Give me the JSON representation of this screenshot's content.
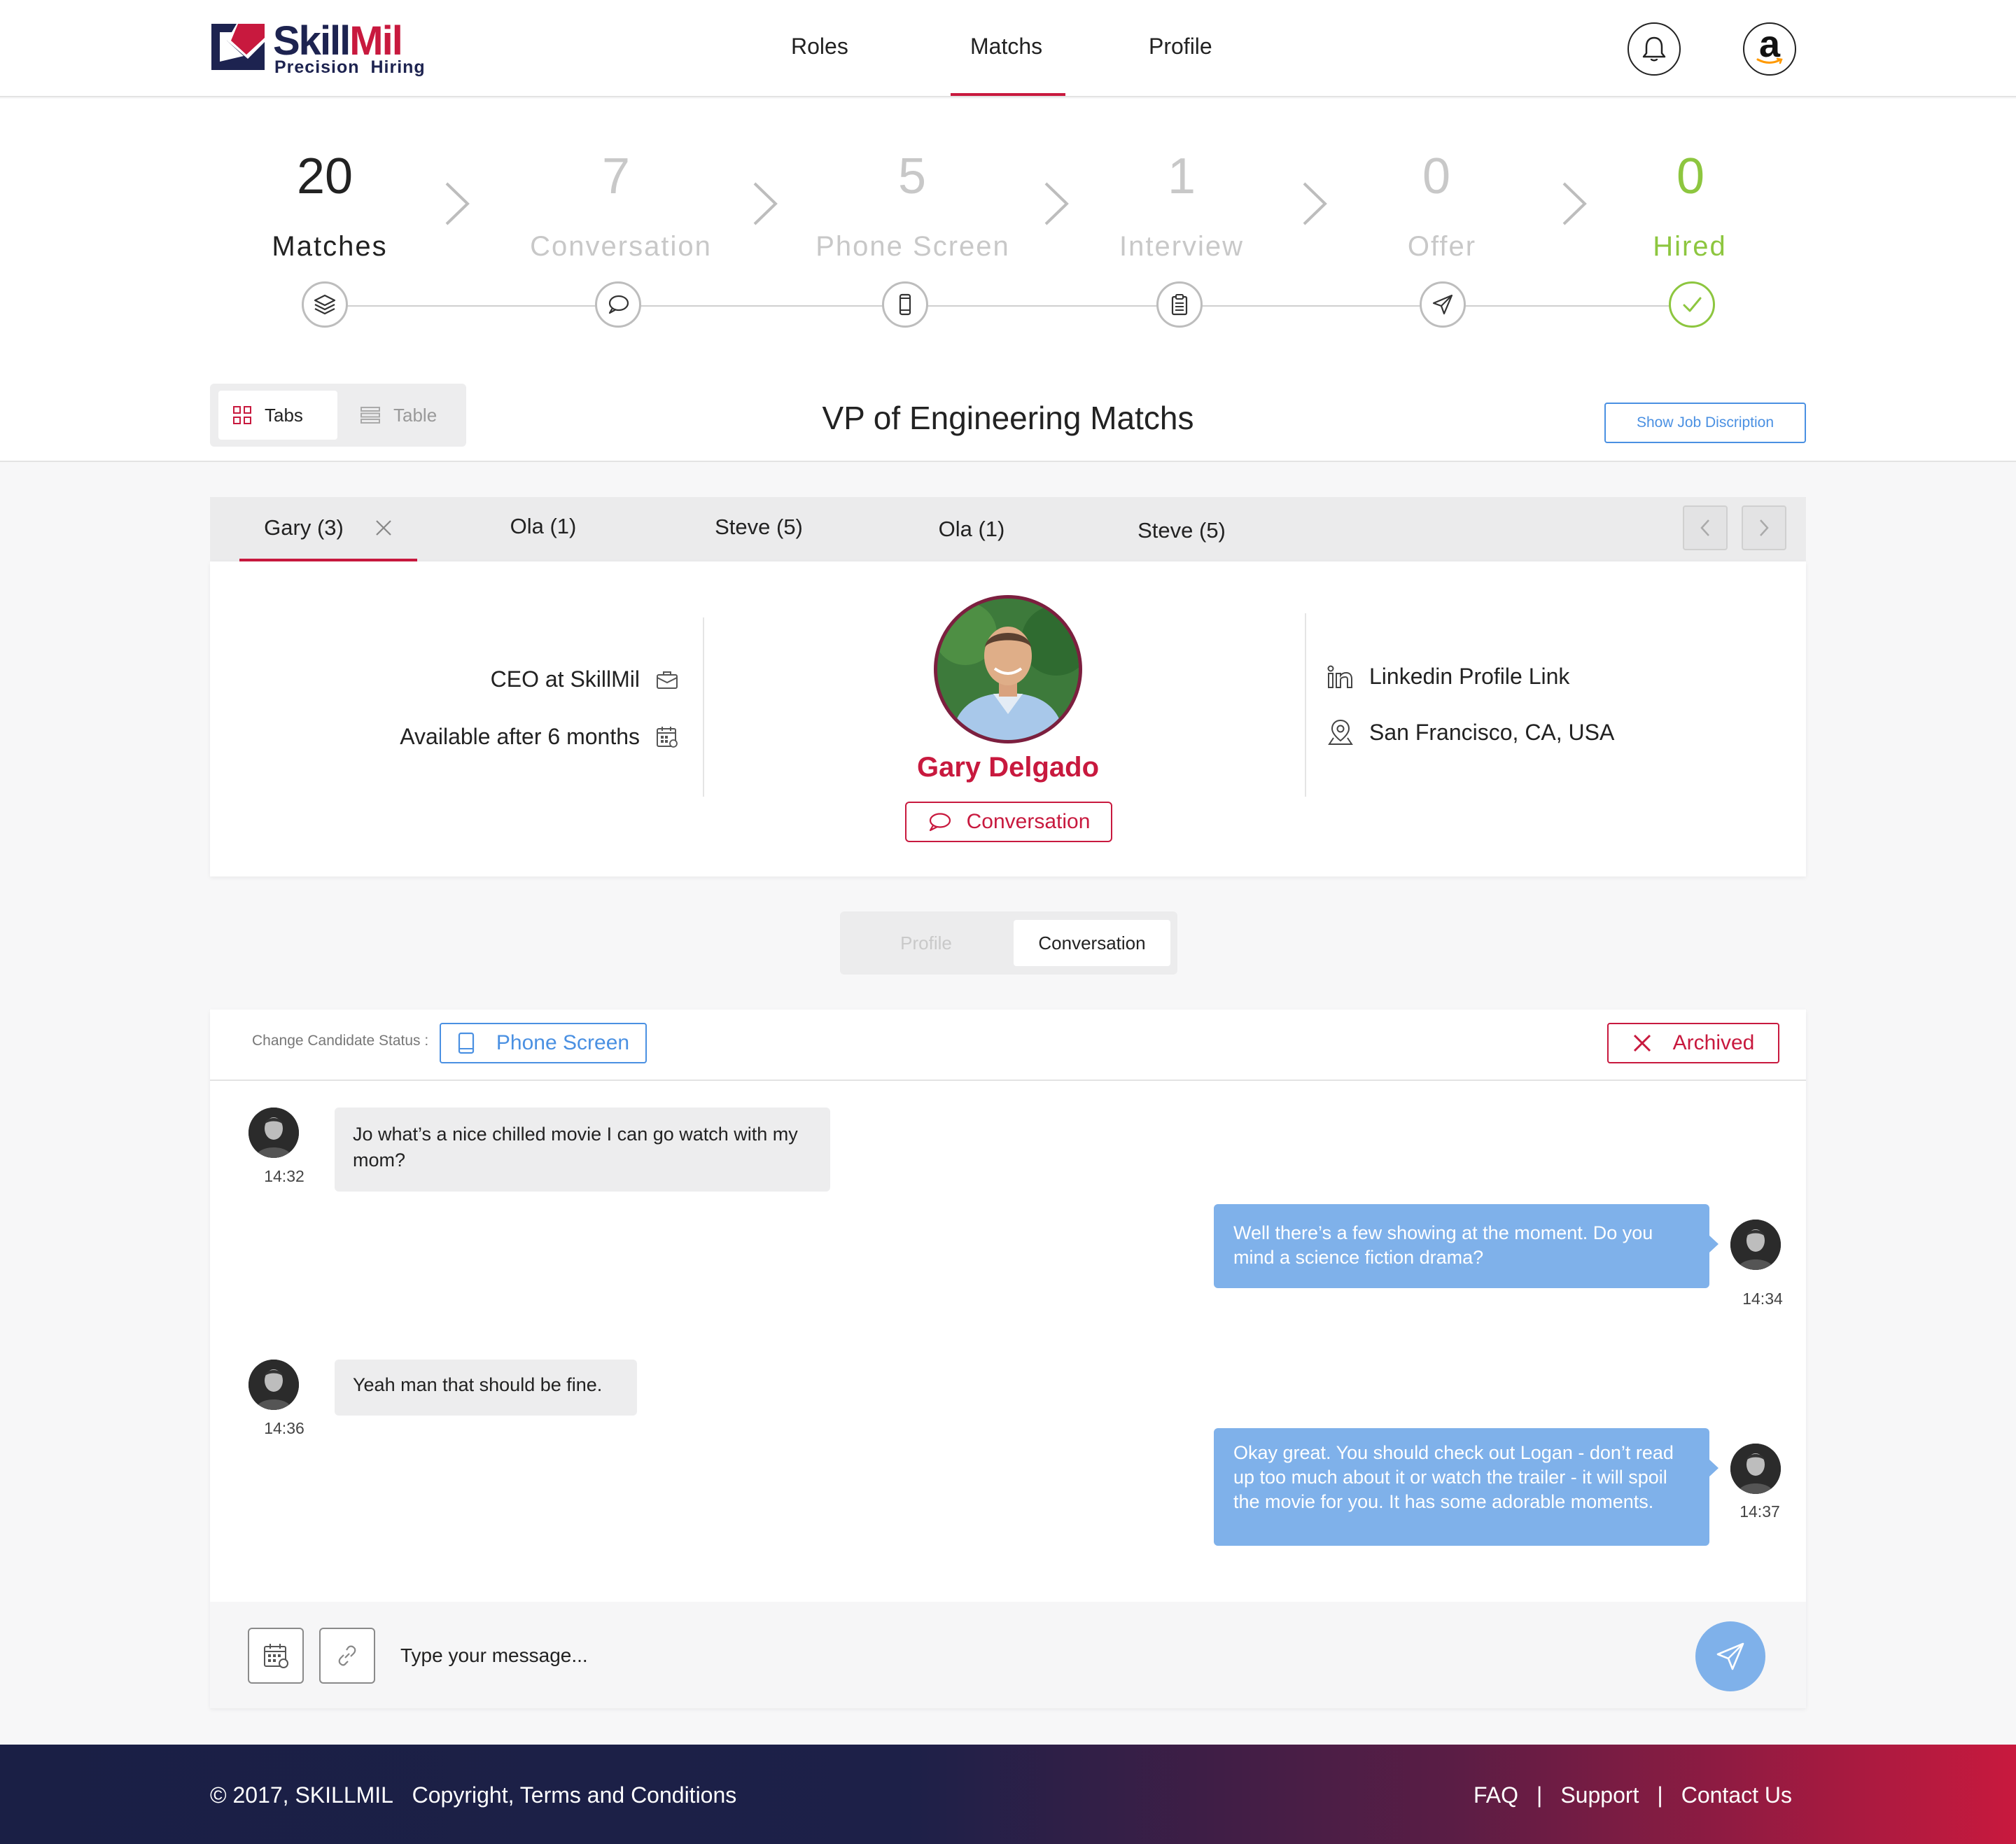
{
  "brand": {
    "name_part1": "Skill",
    "name_part2": "Mil",
    "tagline_part1": "Precision",
    "tagline_part2": "Hiring"
  },
  "nav": {
    "items": [
      "Roles",
      "Matchs",
      "Profile"
    ],
    "active": "Matchs"
  },
  "header": {
    "bell_icon": "bell-icon",
    "account_icon": "amazon-logo"
  },
  "pipeline": {
    "stages": [
      {
        "count": "20",
        "label": "Matches",
        "icon": "layers-icon"
      },
      {
        "count": "7",
        "label": "Conversation",
        "icon": "chat-bubble-icon"
      },
      {
        "count": "5",
        "label": "Phone Screen",
        "icon": "phone-icon"
      },
      {
        "count": "1",
        "label": "Interview",
        "icon": "clipboard-icon"
      },
      {
        "count": "0",
        "label": "Offer",
        "icon": "paper-plane-icon"
      },
      {
        "count": "0",
        "label": "Hired",
        "icon": "check-icon"
      }
    ],
    "hired_color": "#8dc63f"
  },
  "view_toggle": {
    "tabs_label": "Tabs",
    "table_label": "Table",
    "active": "Tabs"
  },
  "page_title": "VP of Engineering Matchs",
  "job_description_button": "Show Job Discription",
  "candidate_tabs": [
    "Gary (3)",
    "Ola (1)",
    "Steve (5)",
    "Ola (1)",
    "Steve (5)"
  ],
  "candidate": {
    "name": "Gary Delgado",
    "title": "CEO at SkillMil",
    "availability": "Available after 6 months",
    "linkedin": "Linkedin Profile Link",
    "location": "San Francisco, CA, USA",
    "status_button": "Conversation"
  },
  "segmented": {
    "profile": "Profile",
    "conversation": "Conversation",
    "active": "Conversation"
  },
  "chat": {
    "status_label": "Change Candidate Status :",
    "status_value": "Phone Screen",
    "archived_label": "Archived",
    "messages": [
      {
        "direction": "in",
        "text": "Jo what’s a nice chilled movie I can go watch with my mom?",
        "time": "14:32"
      },
      {
        "direction": "out",
        "text": "Well there’s a few showing at the moment. Do you mind a science fiction drama?",
        "time": "14:34"
      },
      {
        "direction": "in",
        "text": "Yeah man that should be fine.",
        "time": "14:36"
      },
      {
        "direction": "out",
        "text": "Okay great. You should check out Logan - don’t read up too much about it or watch the trailer - it will spoil the movie for you. It has some adorable moments.",
        "time": "14:37"
      }
    ],
    "input_placeholder": "Type your message..."
  },
  "footer": {
    "copyright": "© 2017, SKILLMIL",
    "terms": "Copyright, Terms and Conditions",
    "links": [
      "FAQ",
      "Support",
      "Contact Us"
    ]
  },
  "colors": {
    "brand_red": "#c8193e",
    "brand_navy": "#1d2350",
    "accent_blue": "#4a90e2",
    "bubble_out": "#7fb1ea"
  }
}
